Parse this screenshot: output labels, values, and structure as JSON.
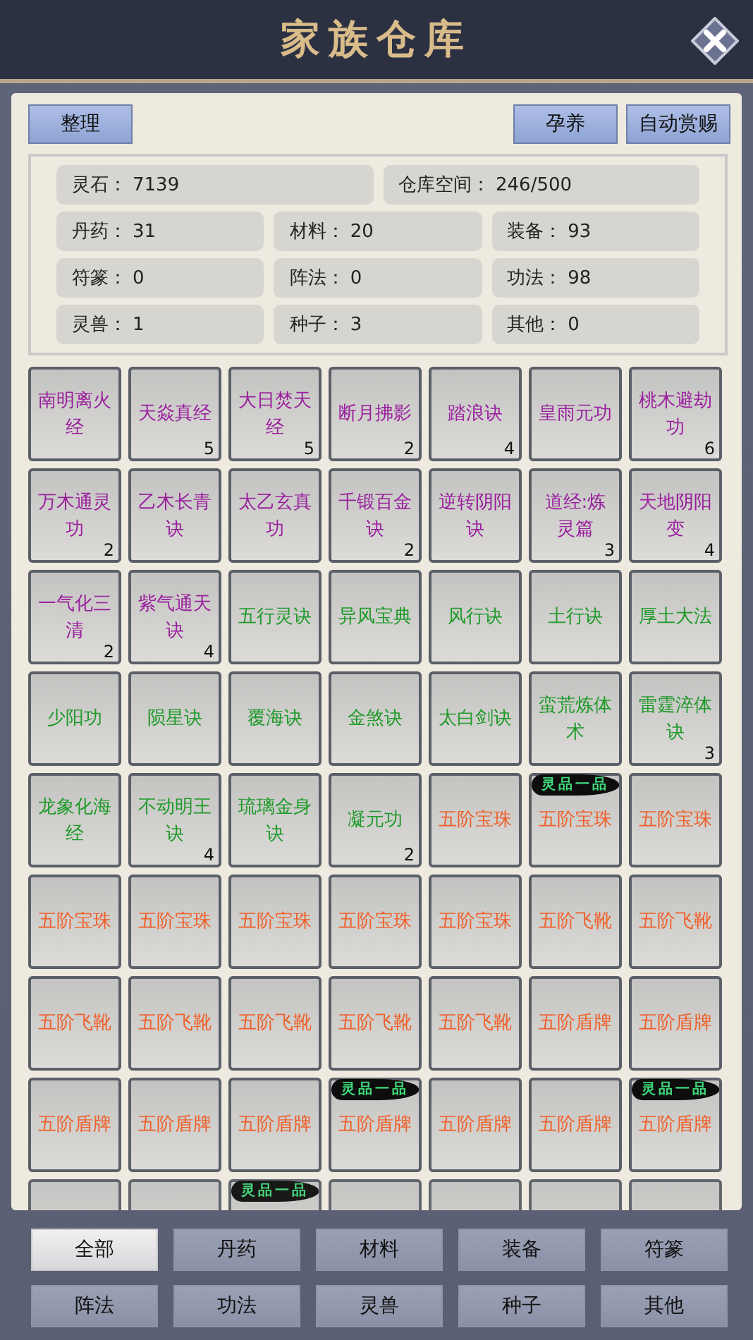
{
  "window": {
    "title": "家族仓库"
  },
  "toolbar": {
    "left": [
      {
        "label": "整理"
      }
    ],
    "right": [
      {
        "label": "孕养"
      },
      {
        "label": "自动赏赐"
      }
    ]
  },
  "stats": [
    [
      {
        "label": "灵石：",
        "value": "7139"
      },
      {
        "label": "仓库空间：",
        "value": "246/500"
      }
    ],
    [
      {
        "label": "丹药：",
        "value": "31"
      },
      {
        "label": "材料：",
        "value": "20"
      },
      {
        "label": "装备：",
        "value": "93"
      }
    ],
    [
      {
        "label": "符篆：",
        "value": "0"
      },
      {
        "label": "阵法：",
        "value": "0"
      },
      {
        "label": "功法：",
        "value": "98"
      }
    ],
    [
      {
        "label": "灵兽：",
        "value": "1"
      },
      {
        "label": "种子：",
        "value": "3"
      },
      {
        "label": "其他：",
        "value": "0"
      }
    ]
  ],
  "items": [
    {
      "name": "南明离火经",
      "color": "#9a1f9e"
    },
    {
      "name": "天焱真经",
      "count": "5",
      "color": "#9a1f9e"
    },
    {
      "name": "大日焚天经",
      "count": "5",
      "color": "#9a1f9e"
    },
    {
      "name": "断月拂影",
      "count": "2",
      "color": "#9a1f9e"
    },
    {
      "name": "踏浪诀",
      "count": "4",
      "color": "#9a1f9e"
    },
    {
      "name": "皇雨元功",
      "color": "#9a1f9e"
    },
    {
      "name": "桃木避劫功",
      "count": "6",
      "color": "#9a1f9e"
    },
    {
      "name": "万木通灵功",
      "count": "2",
      "color": "#9a1f9e"
    },
    {
      "name": "乙木长青诀",
      "color": "#9a1f9e"
    },
    {
      "name": "太乙玄真功",
      "color": "#9a1f9e"
    },
    {
      "name": "千锻百金诀",
      "count": "2",
      "color": "#9a1f9e"
    },
    {
      "name": "逆转阴阳诀",
      "color": "#9a1f9e"
    },
    {
      "name": "道经:炼灵篇",
      "count": "3",
      "color": "#9a1f9e"
    },
    {
      "name": "天地阴阳变",
      "count": "4",
      "color": "#9a1f9e"
    },
    {
      "name": "一气化三清",
      "count": "2",
      "color": "#9a1f9e"
    },
    {
      "name": "紫气通天诀",
      "count": "4",
      "color": "#9a1f9e"
    },
    {
      "name": "五行灵诀",
      "color": "#1f9a2a"
    },
    {
      "name": "异风宝典",
      "color": "#1f9a2a"
    },
    {
      "name": "风行诀",
      "color": "#1f9a2a"
    },
    {
      "name": "土行诀",
      "color": "#1f9a2a"
    },
    {
      "name": "厚土大法",
      "color": "#1f9a2a"
    },
    {
      "name": "少阳功",
      "color": "#1f9a2a"
    },
    {
      "name": "陨星诀",
      "color": "#1f9a2a"
    },
    {
      "name": "覆海诀",
      "color": "#1f9a2a"
    },
    {
      "name": "金煞诀",
      "color": "#1f9a2a"
    },
    {
      "name": "太白剑诀",
      "color": "#1f9a2a"
    },
    {
      "name": "蛮荒炼体术",
      "color": "#1f9a2a"
    },
    {
      "name": "雷霆淬体诀",
      "count": "3",
      "color": "#1f9a2a"
    },
    {
      "name": "龙象化海经",
      "color": "#1f9a2a"
    },
    {
      "name": "不动明王诀",
      "count": "4",
      "color": "#1f9a2a"
    },
    {
      "name": "琉璃金身诀",
      "color": "#1f9a2a"
    },
    {
      "name": "凝元功",
      "count": "2",
      "color": "#1f9a2a"
    },
    {
      "name": "五阶宝珠",
      "color": "#f0602a"
    },
    {
      "name": "五阶宝珠",
      "color": "#f0602a",
      "badge": "灵品一品"
    },
    {
      "name": "五阶宝珠",
      "color": "#f0602a"
    },
    {
      "name": "五阶宝珠",
      "color": "#f0602a"
    },
    {
      "name": "五阶宝珠",
      "color": "#f0602a"
    },
    {
      "name": "五阶宝珠",
      "color": "#f0602a"
    },
    {
      "name": "五阶宝珠",
      "color": "#f0602a"
    },
    {
      "name": "五阶宝珠",
      "color": "#f0602a"
    },
    {
      "name": "五阶飞靴",
      "color": "#f0602a"
    },
    {
      "name": "五阶飞靴",
      "color": "#f0602a"
    },
    {
      "name": "五阶飞靴",
      "color": "#f0602a"
    },
    {
      "name": "五阶飞靴",
      "color": "#f0602a"
    },
    {
      "name": "五阶飞靴",
      "color": "#f0602a"
    },
    {
      "name": "五阶飞靴",
      "color": "#f0602a"
    },
    {
      "name": "五阶飞靴",
      "color": "#f0602a"
    },
    {
      "name": "五阶盾牌",
      "color": "#f0602a"
    },
    {
      "name": "五阶盾牌",
      "color": "#f0602a"
    },
    {
      "name": "五阶盾牌",
      "color": "#f0602a"
    },
    {
      "name": "五阶盾牌",
      "color": "#f0602a"
    },
    {
      "name": "五阶盾牌",
      "color": "#f0602a"
    },
    {
      "name": "五阶盾牌",
      "color": "#f0602a",
      "badge": "灵品一品"
    },
    {
      "name": "五阶盾牌",
      "color": "#f0602a"
    },
    {
      "name": "五阶盾牌",
      "color": "#f0602a"
    },
    {
      "name": "五阶盾牌",
      "color": "#f0602a",
      "badge": "灵品一品"
    },
    {
      "kind": "empty"
    },
    {
      "kind": "empty"
    },
    {
      "kind": "empty",
      "badge": "灵品一品"
    },
    {
      "kind": "empty"
    },
    {
      "kind": "empty"
    },
    {
      "kind": "empty"
    },
    {
      "kind": "empty"
    }
  ],
  "filters": [
    {
      "label": "全部",
      "selected": true
    },
    {
      "label": "丹药",
      "selected": false
    },
    {
      "label": "材料",
      "selected": false
    },
    {
      "label": "装备",
      "selected": false
    },
    {
      "label": "符篆",
      "selected": false
    },
    {
      "label": "阵法",
      "selected": false
    },
    {
      "label": "功法",
      "selected": false
    },
    {
      "label": "灵兽",
      "selected": false
    },
    {
      "label": "种子",
      "selected": false
    },
    {
      "label": "其他",
      "selected": false
    }
  ]
}
